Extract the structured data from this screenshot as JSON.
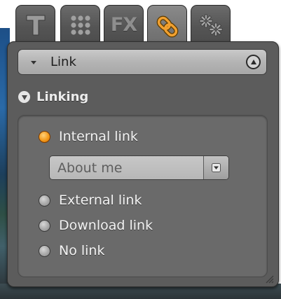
{
  "tabs": [
    {
      "id": "text",
      "icon": "text-icon"
    },
    {
      "id": "grid",
      "icon": "grid-icon"
    },
    {
      "id": "fx",
      "label": "FX",
      "icon": "fx-icon"
    },
    {
      "id": "link",
      "icon": "link-icon",
      "active": true
    },
    {
      "id": "settings",
      "icon": "gears-icon"
    }
  ],
  "panel": {
    "dropdown_label": "Link",
    "section_label": "Linking",
    "options": [
      {
        "label": "Internal link",
        "selected": true
      },
      {
        "label": "External link",
        "selected": false
      },
      {
        "label": "Download link",
        "selected": false
      },
      {
        "label": "No link",
        "selected": false
      }
    ],
    "internal_page_select": {
      "value": "About me"
    }
  },
  "colors": {
    "accent_radio": "#f39a1c",
    "panel_bg": "#5c5c5c",
    "inner_bg": "#6a6a6a"
  }
}
